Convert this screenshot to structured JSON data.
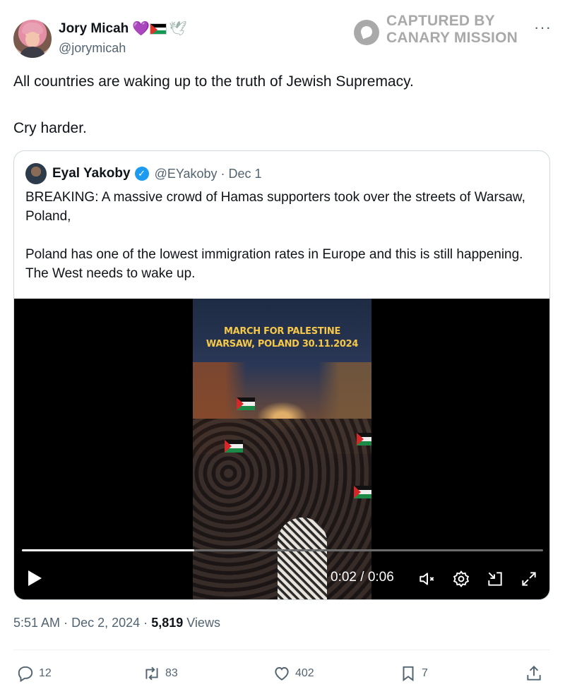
{
  "author": {
    "display_name": "Jory Micah",
    "emoji_heart": "💜",
    "emoji_dove": "🕊",
    "handle": "@jorymicah"
  },
  "watermark": {
    "line1": "CAPTURED BY",
    "line2": "CANARY MISSION"
  },
  "more_label": "···",
  "tweet": {
    "line1": "All countries are waking up to the truth of Jewish Supremacy.",
    "line2": "Cry harder."
  },
  "quote": {
    "display_name": "Eyal Yakoby",
    "verified_mark": "✓",
    "handle": "@EYakoby",
    "separator": "·",
    "date": "Dec 1",
    "para1": "BREAKING: A massive crowd of Hamas supporters took over the streets of Warsaw, Poland,",
    "para2": "Poland has one of the lowest immigration rates in Europe and this is still happening. The West needs to wake up.",
    "video": {
      "caption_line1": "MARCH FOR PALESTINE",
      "caption_line2": "WARSAW, POLAND 30.11.2024",
      "time": "0:02 / 0:06",
      "progress_fraction": 0.33
    }
  },
  "meta": {
    "time": "5:51 AM",
    "sep1": "·",
    "date": "Dec 2, 2024",
    "sep2": "·",
    "views_count": "5,819",
    "views_label": "Views"
  },
  "actions": {
    "replies": "12",
    "reposts": "83",
    "likes": "402",
    "bookmarks": "7"
  },
  "colors": {
    "text": "#0f1419",
    "secondary": "#536471",
    "verified": "#1d9bf0",
    "border": "#cfd9de"
  }
}
